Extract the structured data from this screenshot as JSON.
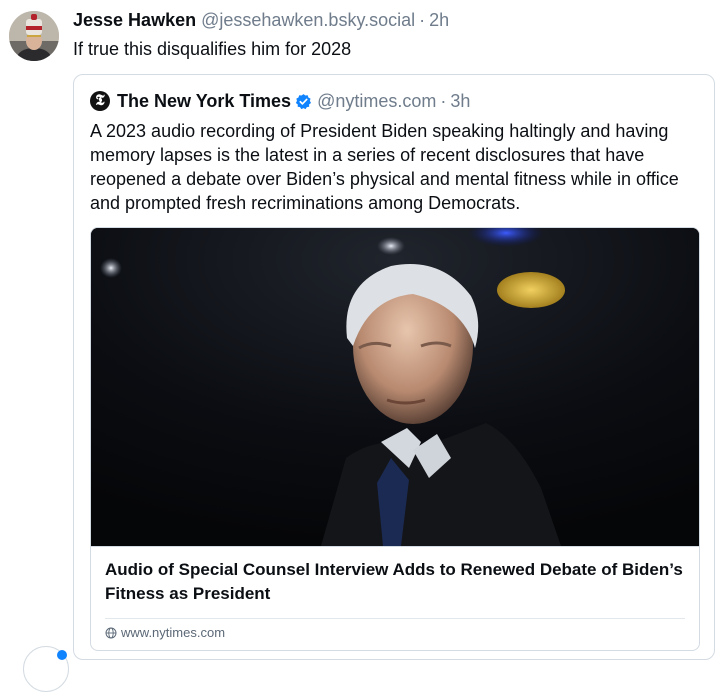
{
  "post": {
    "author_name": "Jesse Hawken",
    "author_handle": "@jessehawken.bsky.social",
    "separator": "·",
    "time": "2h",
    "text": "If true this disqualifies him for 2028"
  },
  "quote": {
    "author_name": "The New York Times",
    "author_handle": "@nytimes.com",
    "separator": "·",
    "time": "3h",
    "icon_letter": "𝕿",
    "verified_color": "#1083fe",
    "text": "A 2023 audio recording of President Biden speaking haltingly and having memory lapses is the latest in a series of recent disclosures that have reopened a debate over Biden’s physical and mental fitness while in office and prompted fresh recriminations among Democrats."
  },
  "link_card": {
    "title": "Audio of Special Counsel Interview Adds to Renewed Debate of Biden’s Fitness as President",
    "domain": "www.nytimes.com",
    "domain_icon": "globe-icon"
  },
  "colors": {
    "text": "#0b0f14",
    "muted": "#6f7c8b",
    "border": "#d4dbe2",
    "accent": "#1083fe"
  }
}
